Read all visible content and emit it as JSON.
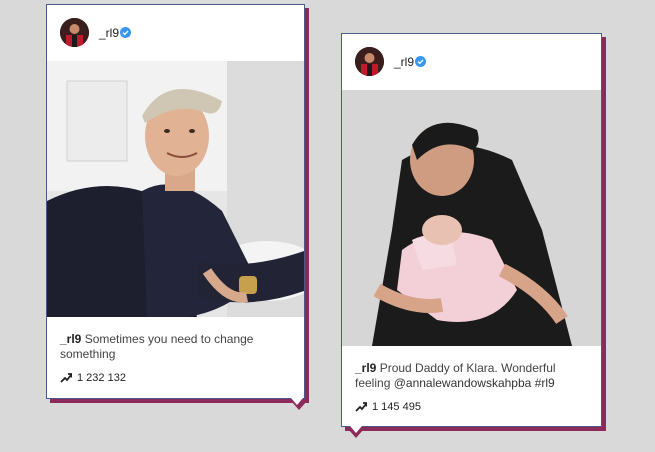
{
  "posts": [
    {
      "username": "_rl9",
      "caption_user": "_rl9",
      "caption_text": "Sometimes you need to change something",
      "stat_value": "1 232 132",
      "icons": [
        "avatar",
        "verified-icon",
        "trending-icon"
      ]
    },
    {
      "username": "_rl9",
      "caption_user": "_rl9",
      "caption_text": "Proud Daddy of Klara. Wonderful feeling",
      "mention": "@annalewandowskahpba",
      "hashtag": "#rl9",
      "stat_value": "1 145 495",
      "icons": [
        "avatar",
        "verified-icon",
        "trending-icon"
      ]
    }
  ],
  "colors": {
    "background": "#d9d9d9",
    "card_shadow": "#8c2a5a",
    "verified": "#3897f0"
  }
}
